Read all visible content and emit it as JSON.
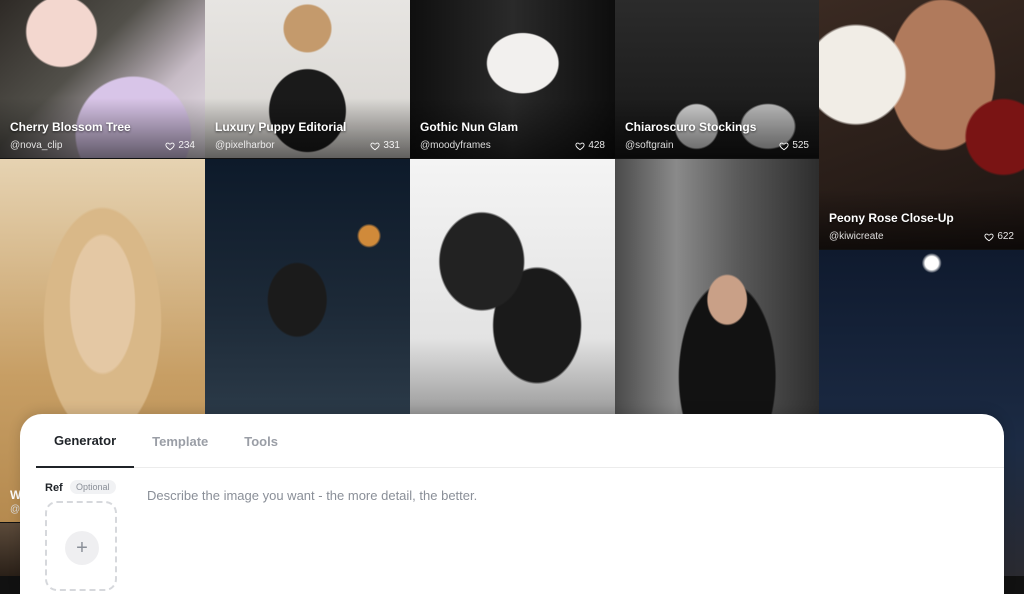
{
  "gallery": {
    "tiles": [
      {
        "title": "Cherry Blossom Tree",
        "author": "@nova_clip",
        "likes": "234"
      },
      {
        "title": "Luxury Puppy Editorial",
        "author": "@pixelharbor",
        "likes": "331"
      },
      {
        "title": "Gothic Nun Glam",
        "author": "@moodyframes",
        "likes": "428"
      },
      {
        "title": "Chiaroscuro Stockings",
        "author": "@softgrain",
        "likes": "525"
      },
      {
        "title": "Peony Rose Close-Up",
        "author": "@kiwicreate",
        "likes": "622"
      }
    ],
    "peek_title": "W",
    "peek_author": "@"
  },
  "panel": {
    "tabs": [
      {
        "label": "Generator"
      },
      {
        "label": "Template"
      },
      {
        "label": "Tools"
      }
    ],
    "ref_label": "Ref",
    "optional_badge": "Optional",
    "plus": "+",
    "prompt_placeholder": "Describe the image you want - the more detail, the better."
  },
  "colors": {
    "panel_bg": "#ffffff",
    "tab_active": "#1f2328",
    "tab_inactive": "#9a9ea6"
  }
}
